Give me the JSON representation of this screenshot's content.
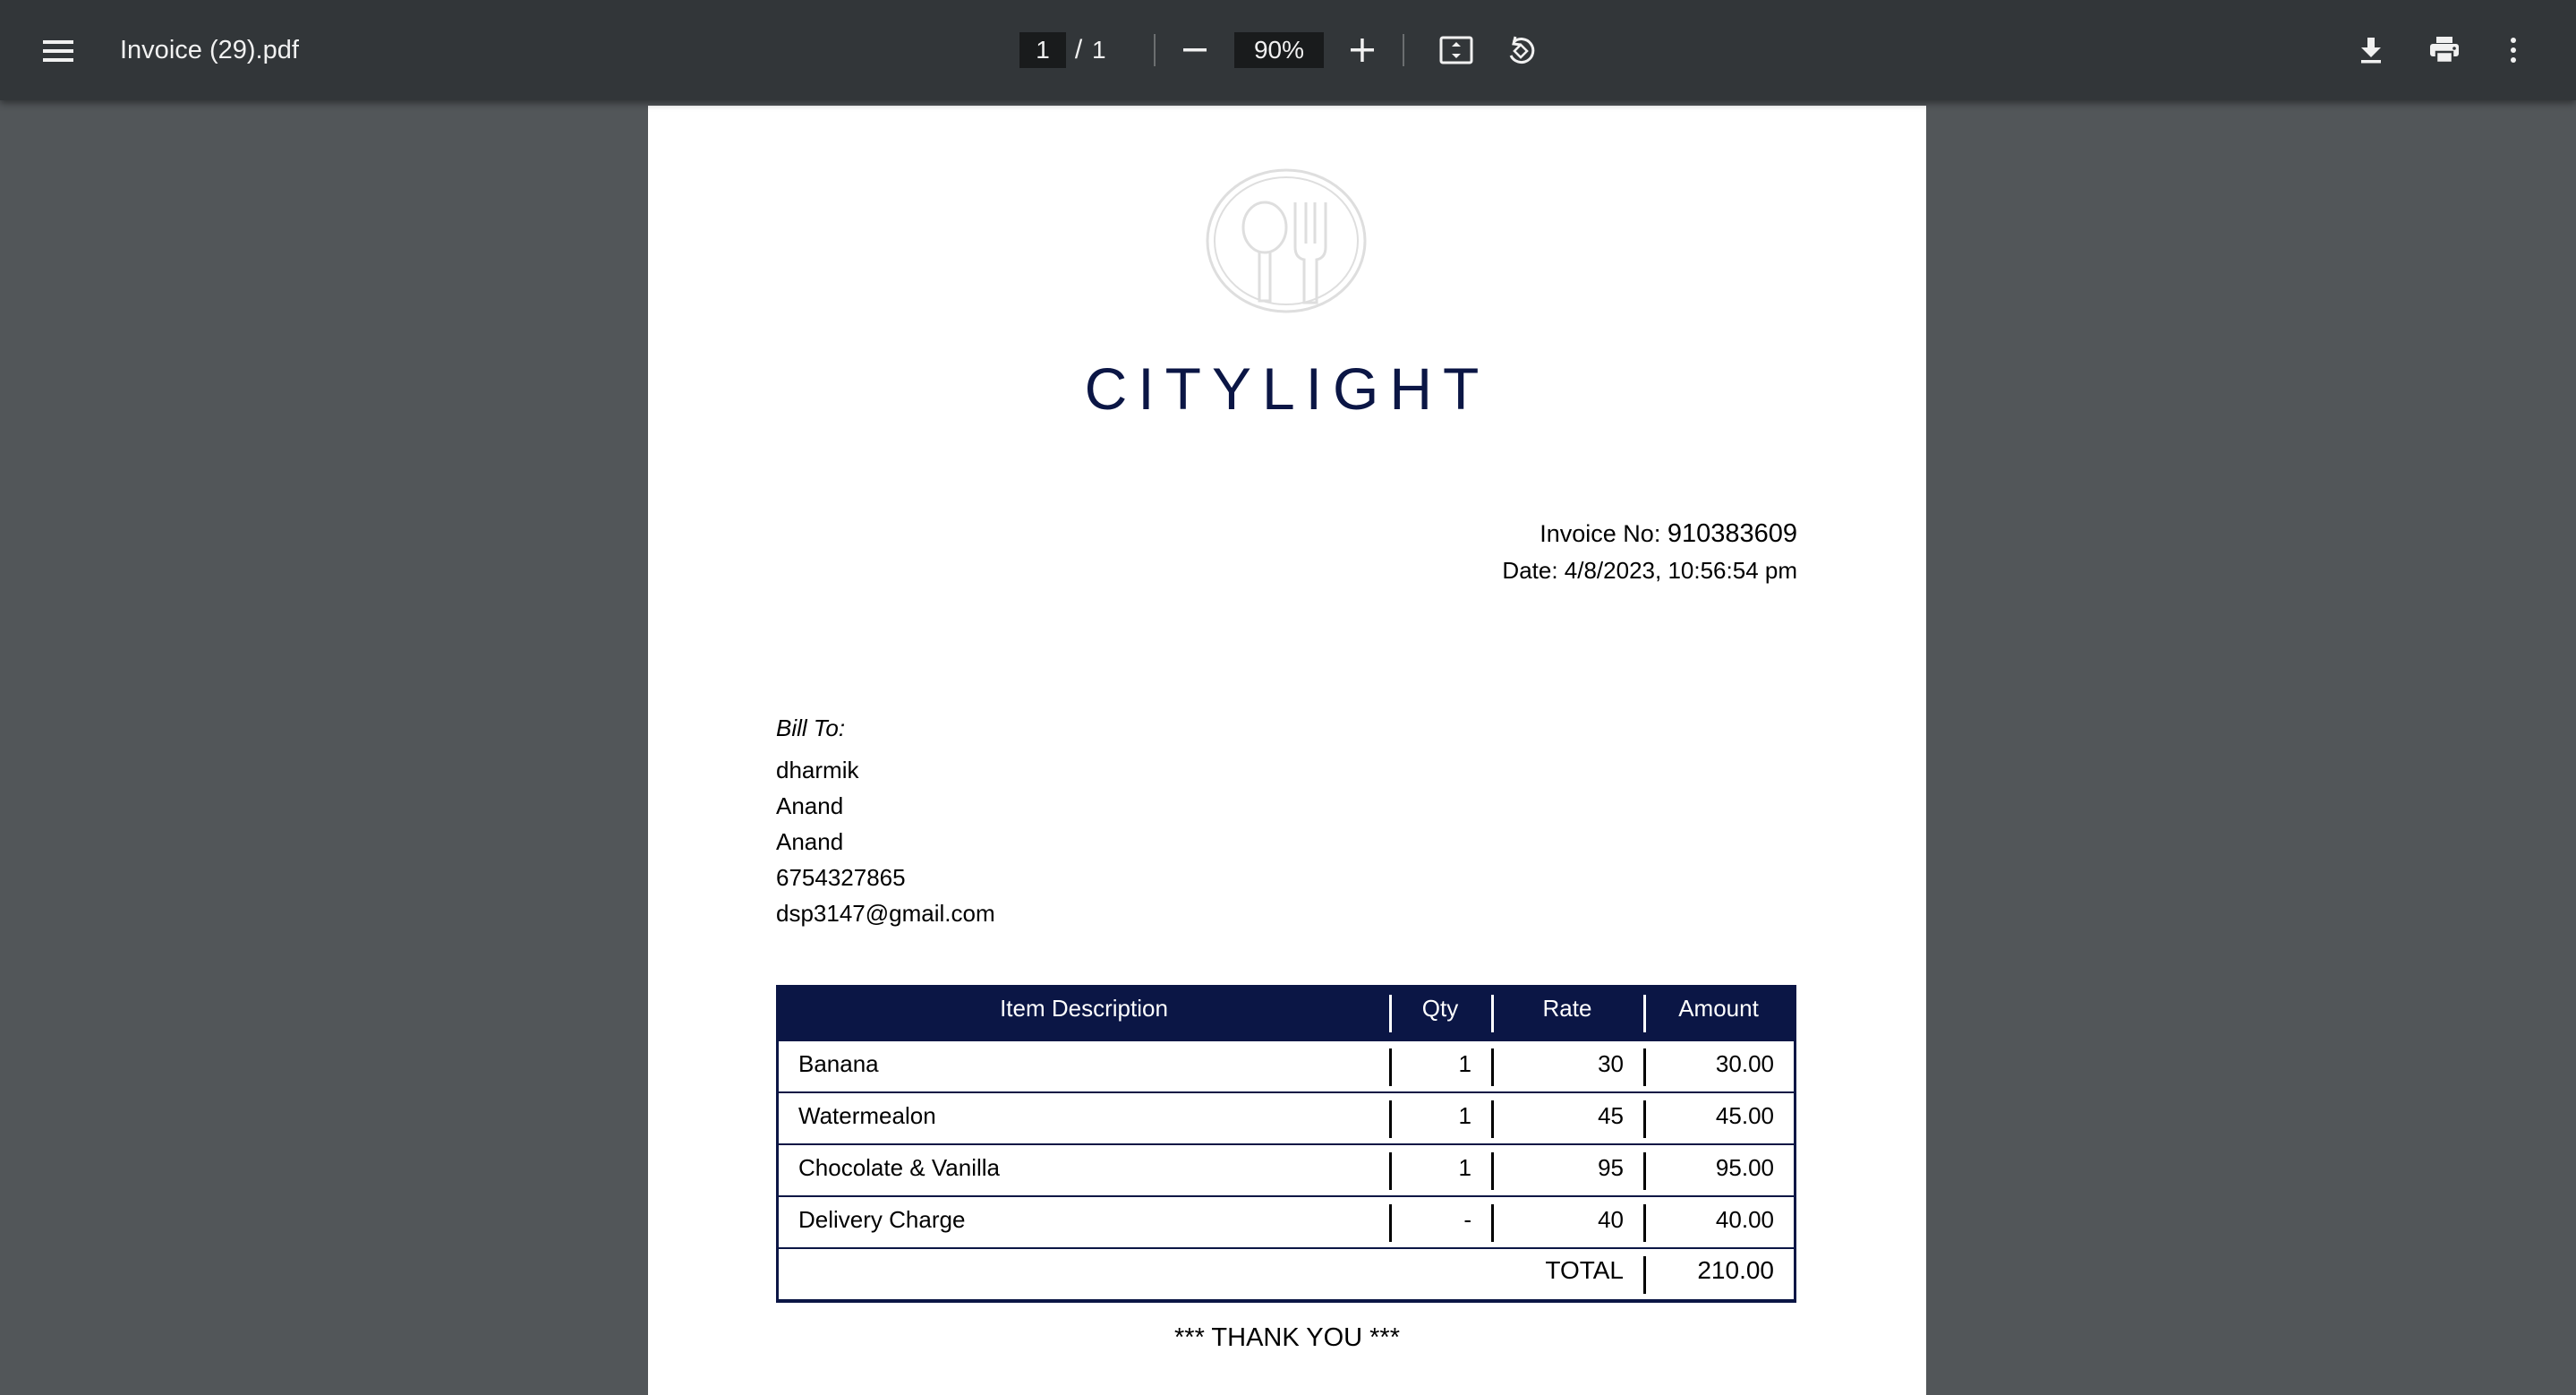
{
  "toolbar": {
    "title": "Invoice (29).pdf",
    "page_current": "1",
    "page_separator": "/",
    "page_total": "1",
    "zoom": "90%",
    "icons": [
      "menu-icon",
      "zoom-out-icon",
      "zoom-in-icon",
      "fit-page-icon",
      "rotate-icon",
      "download-icon",
      "print-icon",
      "more-vert-icon"
    ]
  },
  "invoice": {
    "brand": "CITYLIGHT",
    "invoice_no_label": "Invoice No:",
    "invoice_no": "910383609",
    "date": "Date: 4/8/2023, 10:56:54 pm",
    "bill_to_label": "Bill To:",
    "bill_to": [
      "dharmik",
      "Anand",
      "Anand",
      "6754327865",
      "dsp3147@gmail.com"
    ],
    "table": {
      "headers": [
        "Item Description",
        "Qty",
        "Rate",
        "Amount"
      ],
      "rows": [
        [
          "Banana",
          "1",
          "30",
          "30.00"
        ],
        [
          "Watermealon",
          "1",
          "45",
          "45.00"
        ],
        [
          "Chocolate & Vanilla",
          "1",
          "95",
          "95.00"
        ],
        [
          "Delivery Charge",
          "-",
          "40",
          "40.00"
        ]
      ],
      "total_label": "TOTAL",
      "total_value": "210.00"
    },
    "thanks": "*** THANK YOU ***"
  },
  "colors": {
    "toolbar_bg": "#323639",
    "viewer_bg": "#525659",
    "brand_navy": "#0b1645"
  }
}
